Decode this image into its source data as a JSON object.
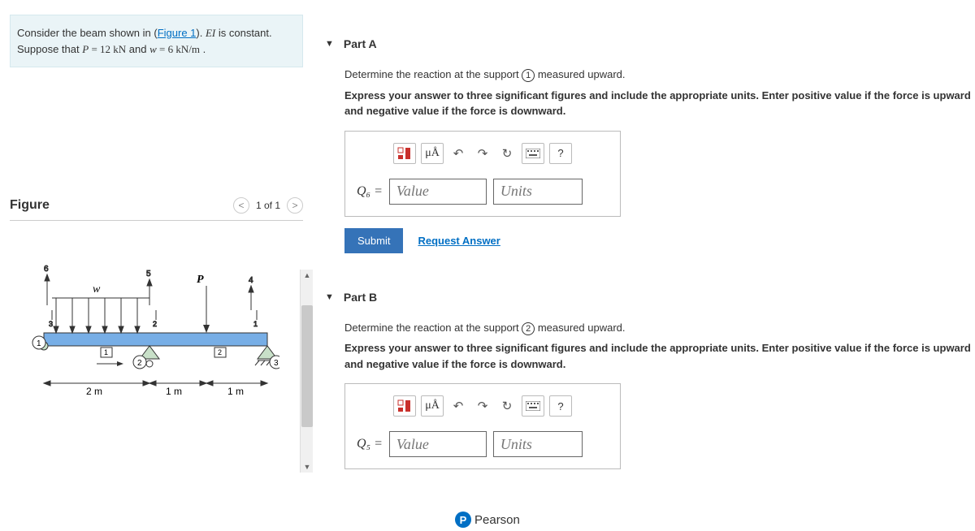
{
  "problem": {
    "prefix": "Consider the beam shown in (",
    "figure_link": "Figure 1",
    "suffix1": "). ",
    "ei_html": "EI",
    "suffix2": " is constant.",
    "line2_pre": "Suppose that ",
    "P_sym": "P",
    "P_val": " = 12  kN",
    "and": " and ",
    "w_sym": "w",
    "w_val": " = 6  kN/m",
    "tail": " ."
  },
  "figure": {
    "title": "Figure",
    "pager": "1 of 1",
    "labels": {
      "w": "w",
      "P": "P",
      "dim1": "2 m",
      "dim2": "1 m",
      "dim3": "1 m"
    }
  },
  "partA": {
    "title": "Part A",
    "desc_pre": "Determine the reaction at the support ",
    "desc_circ": "1",
    "desc_post": " measured upward.",
    "instr": "Express your answer to three significant figures and include the appropriate units. Enter positive value if the force is upward and negative value if the force is downward.",
    "var": "Q₆ =",
    "val_ph": "Value",
    "unit_ph": "Units",
    "submit": "Submit",
    "request": "Request Answer",
    "mu": "μÅ",
    "q": "?"
  },
  "partB": {
    "title": "Part B",
    "desc_pre": "Determine the reaction at the support ",
    "desc_circ": "2",
    "desc_post": " measured upward.",
    "instr": "Express your answer to three significant figures and include the appropriate units. Enter positive value if the force is upward and negative value if the force is downward.",
    "var": "Q₅ =",
    "val_ph": "Value",
    "unit_ph": "Units",
    "mu": "μÅ",
    "q": "?"
  },
  "footer": {
    "brand": "Pearson",
    "badge": "P"
  }
}
